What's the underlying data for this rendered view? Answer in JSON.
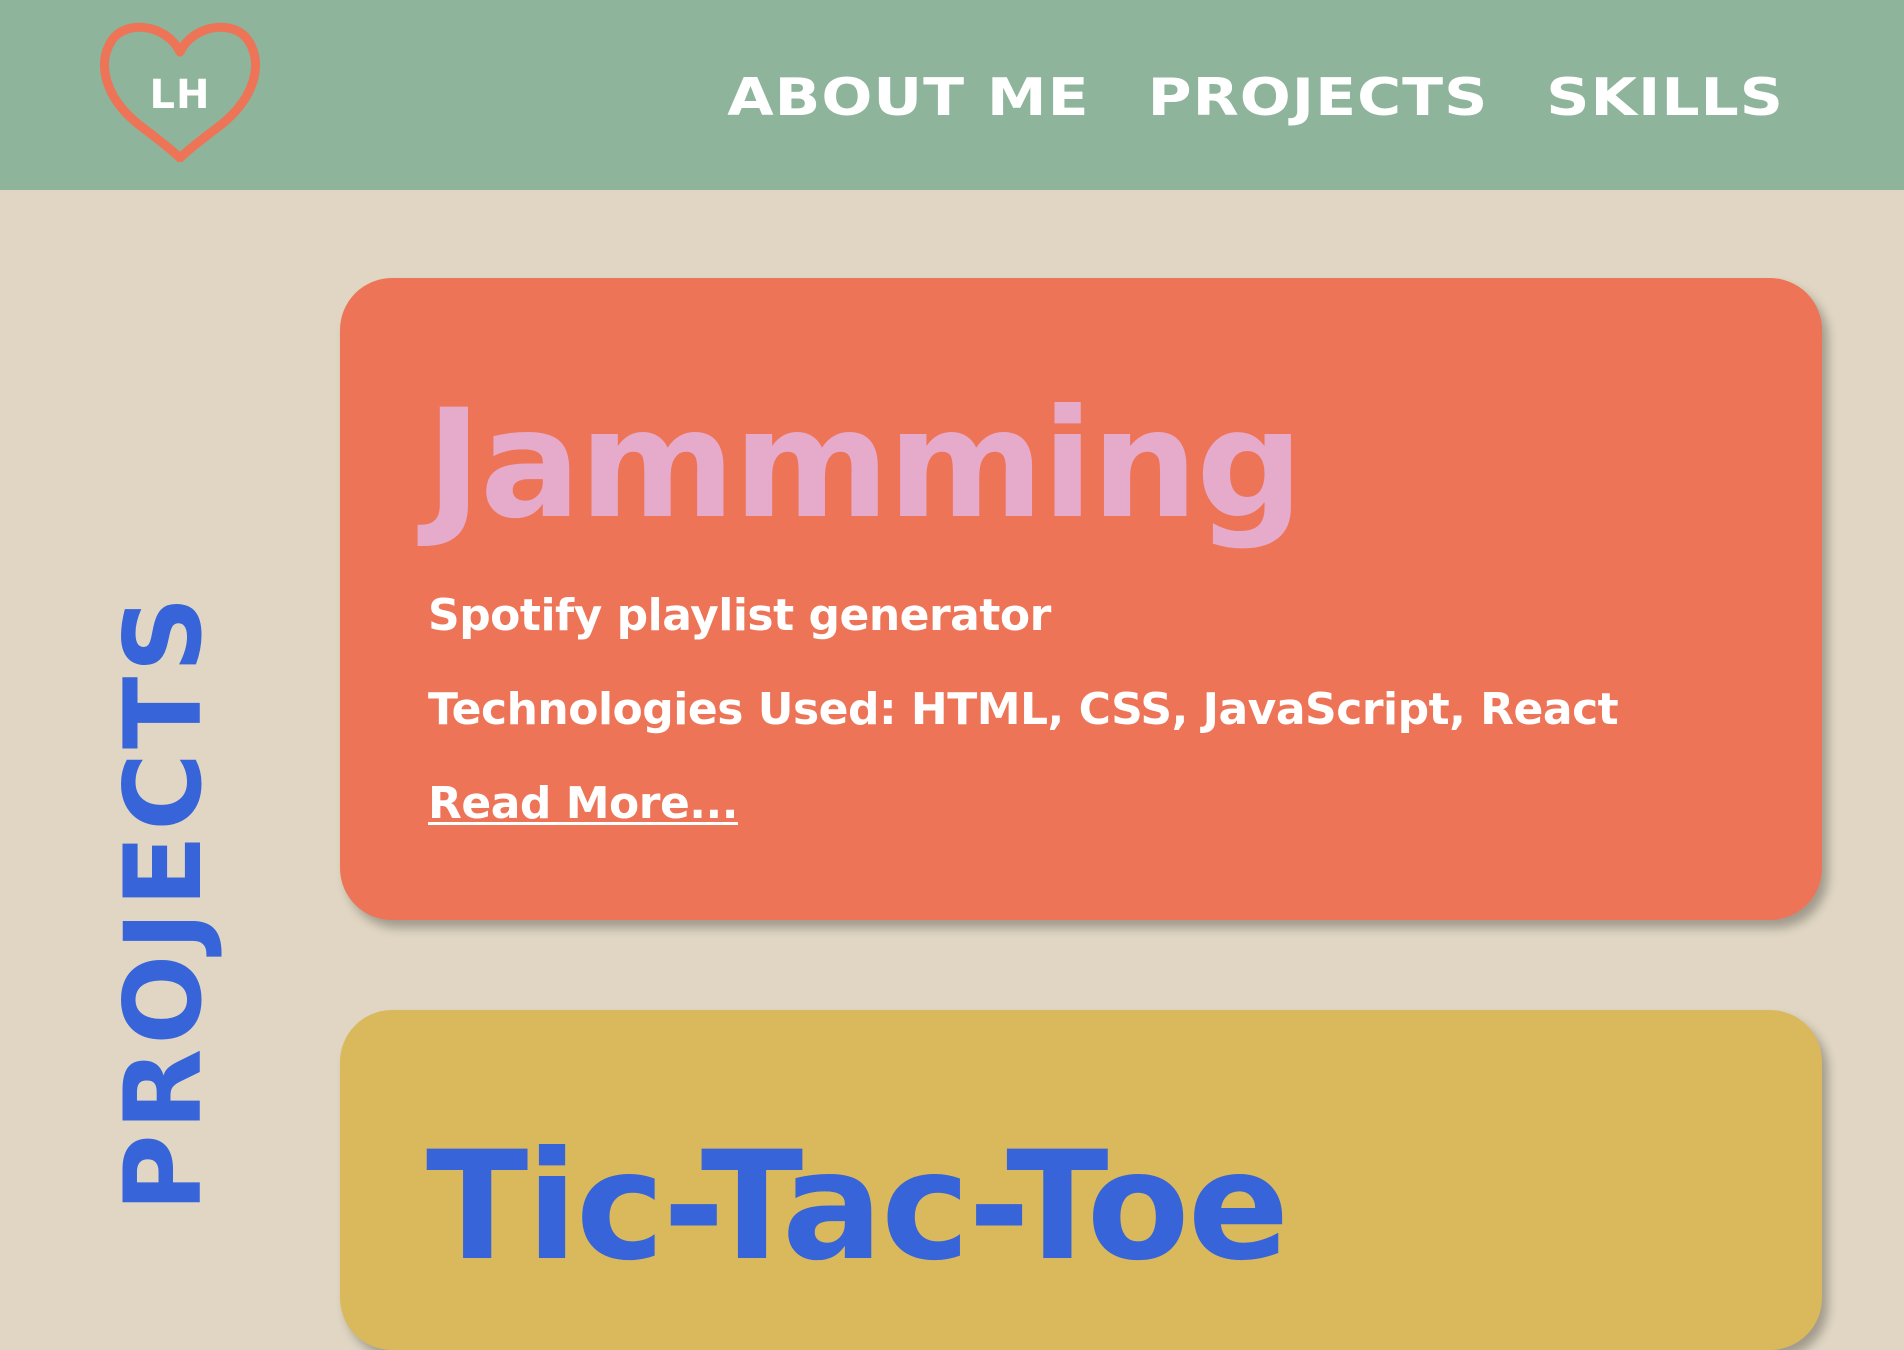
{
  "header": {
    "logo_text": "LH",
    "nav": [
      {
        "label": "ABOUT ME"
      },
      {
        "label": "PROJECTS"
      },
      {
        "label": "SKILLS"
      }
    ]
  },
  "section": {
    "title": "PROJECTS"
  },
  "projects": [
    {
      "title": "Jammming",
      "description": "Spotify playlist generator",
      "technologies": "Technologies Used: HTML, CSS, JavaScript, React",
      "link_label": "Read More..."
    },
    {
      "title": "Tic-Tac-Toe"
    }
  ],
  "colors": {
    "header_bg": "#8eb49b",
    "page_bg": "#e0d6c3",
    "accent_coral": "#ed7457",
    "accent_pink": "#e6aacb",
    "accent_blue": "#3764d8",
    "accent_mustard": "#dab95c"
  },
  "icons": {
    "logo": "heart-icon"
  }
}
